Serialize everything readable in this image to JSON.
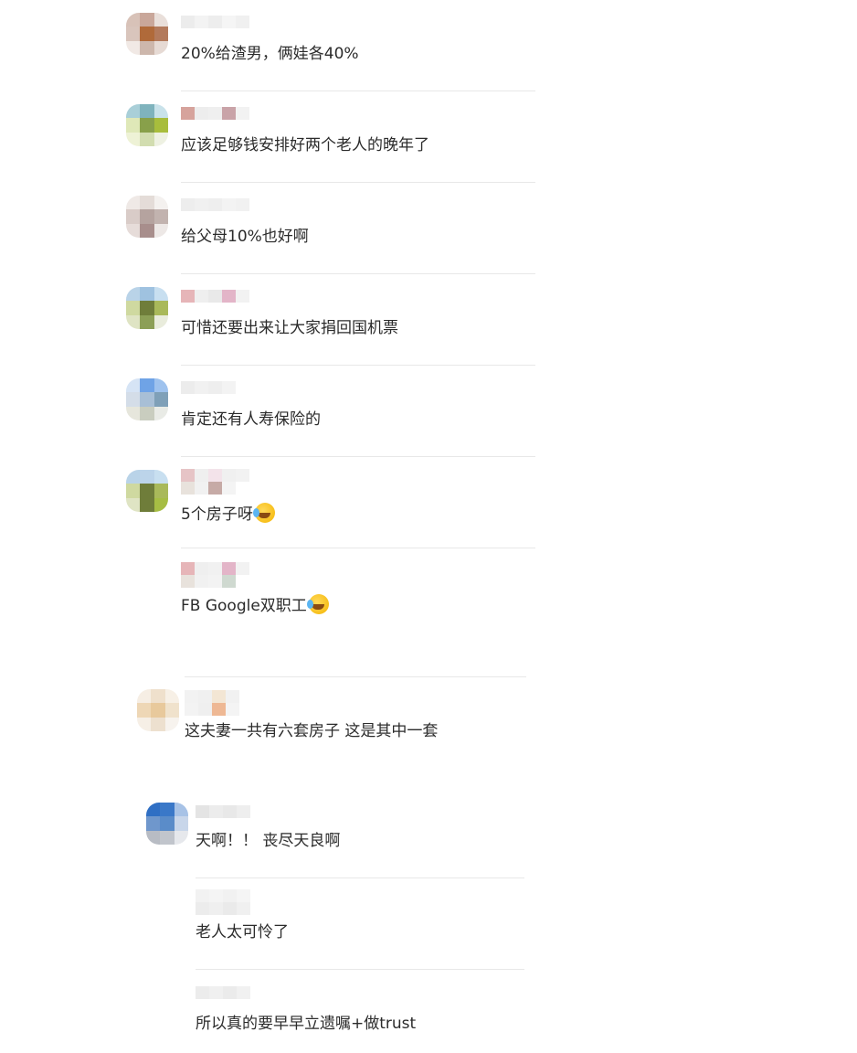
{
  "comments": [
    {
      "text": "20%给渣男，俩娃各40%",
      "emoji": false
    },
    {
      "text": "应该足够钱安排好两个老人的晚年了",
      "emoji": false
    },
    {
      "text": "给父母10%也好啊",
      "emoji": false
    },
    {
      "text": "可惜还要出来让大家捐回国机票",
      "emoji": false
    },
    {
      "text": "肯定还有人寿保险的",
      "emoji": false
    },
    {
      "text": "5个房子呀",
      "emoji": true,
      "emoji_name": "laughing-crying-emoji"
    },
    {
      "text": "FB Google双职工",
      "emoji": true,
      "emoji_name": "laughing-crying-emoji"
    },
    {
      "text": "这夫妻一共有六套房子 这是其中一套",
      "emoji": false
    },
    {
      "text": "天啊！！ 丧尽天良啊",
      "emoji": false
    },
    {
      "text": "老人太可怜了",
      "emoji": false
    },
    {
      "text": "所以真的要早早立遗嘱+做trust",
      "emoji": false
    }
  ]
}
